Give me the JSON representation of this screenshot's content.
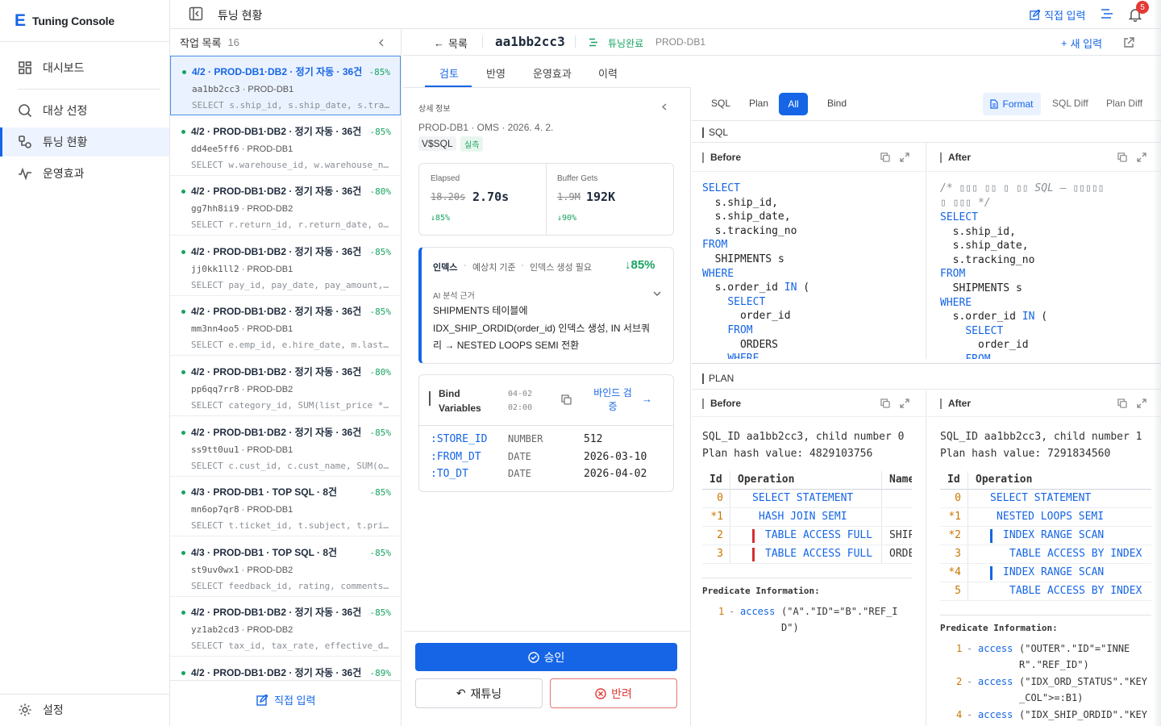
{
  "app": {
    "brand_letter": "E",
    "brand_name": "Tuning Console"
  },
  "sidebar": {
    "items": [
      {
        "label": "대시보드",
        "icon": "dashboard-icon"
      },
      {
        "label": "대상 선정",
        "icon": "search-icon"
      },
      {
        "label": "튜닝 현황",
        "icon": "tuning-icon",
        "active": true
      },
      {
        "label": "운영효과",
        "icon": "pulse-icon"
      }
    ],
    "settings_label": "설정"
  },
  "topbar": {
    "title": "튜닝 현황",
    "direct_input": "직접 입력",
    "notification_count": "5"
  },
  "queue": {
    "title": "작업 목록",
    "count": "16",
    "footer_button": "직접 입력",
    "items": [
      {
        "title": "4/2 · PROD-DB1·DB2 · 정기 자동 · 36건",
        "pct": "-85%",
        "id": "aa1bb2cc3",
        "db": "PROD-DB1",
        "sql": "SELECT s.ship_id, s.ship_date, s.tracking_no FROM SHIPMENTS s"
      },
      {
        "title": "4/2 · PROD-DB1·DB2 · 정기 자동 · 36건",
        "pct": "-85%",
        "id": "dd4ee5ff6",
        "db": "PROD-DB1",
        "sql": "SELECT w.warehouse_id, w.warehouse_name"
      },
      {
        "title": "4/2 · PROD-DB1·DB2 · 정기 자동 · 36건",
        "pct": "-80%",
        "id": "gg7hh8ii9",
        "db": "PROD-DB2",
        "sql": "SELECT r.return_id, r.return_date, o.order_id"
      },
      {
        "title": "4/2 · PROD-DB1·DB2 · 정기 자동 · 36건",
        "pct": "-85%",
        "id": "jj0kk1ll2",
        "db": "PROD-DB1",
        "sql": "SELECT pay_id, pay_date, pay_amount, status"
      },
      {
        "title": "4/2 · PROD-DB1·DB2 · 정기 자동 · 36건",
        "pct": "-85%",
        "id": "mm3nn4oo5",
        "db": "PROD-DB1",
        "sql": "SELECT e.emp_id, e.hire_date, m.last_name"
      },
      {
        "title": "4/2 · PROD-DB1·DB2 · 정기 자동 · 36건",
        "pct": "-80%",
        "id": "pp6qq7rr8",
        "db": "PROD-DB2",
        "sql": "SELECT category_id, SUM(list_price * qty)"
      },
      {
        "title": "4/2 · PROD-DB1·DB2 · 정기 자동 · 36건",
        "pct": "-85%",
        "id": "ss9tt0uu1",
        "db": "PROD-DB1",
        "sql": "SELECT c.cust_id, c.cust_name, SUM(o.amount)"
      },
      {
        "title": "4/3 · PROD-DB1 · TOP SQL · 8건",
        "pct": "-85%",
        "id": "mn6op7qr8",
        "db": "PROD-DB1",
        "sql": "SELECT t.ticket_id, t.subject, t.priority"
      },
      {
        "title": "4/3 · PROD-DB1 · TOP SQL · 8건",
        "pct": "-85%",
        "id": "st9uv0wx1",
        "db": "PROD-DB2",
        "sql": "SELECT feedback_id, rating, comments, created"
      },
      {
        "title": "4/2 · PROD-DB1·DB2 · 정기 자동 · 36건",
        "pct": "-85%",
        "id": "yz1ab2cd3",
        "db": "PROD-DB2",
        "sql": "SELECT tax_id, tax_rate, effective_date"
      },
      {
        "title": "4/2 · PROD-DB1·DB2 · 정기 자동 · 36건",
        "pct": "-89%",
        "id": "",
        "db": "",
        "sql": ""
      }
    ]
  },
  "detail": {
    "back_label": "목록",
    "sql_id": "aa1bb2cc3",
    "status": "튜닝완료",
    "db": "PROD-DB1",
    "new_input": "새 입력",
    "tabs": [
      "검토",
      "반영",
      "운영효과",
      "이력"
    ],
    "info_title": "상세 정보",
    "info_meta": "PROD-DB1 · OMS · 2026. 4. 2.",
    "source_tag": "V$SQL",
    "measure_tag": "실측",
    "metrics": [
      {
        "label": "Elapsed",
        "before": "18.20s",
        "after": "2.70s",
        "delta": "↓85%"
      },
      {
        "label": "Buffer Gets",
        "before": "1.9M",
        "after": "192K",
        "delta": "↓90%"
      }
    ],
    "recommendation": {
      "type": "인덱스",
      "basis": "예상치 기준",
      "action": "인덱스 생성 필요",
      "improvement": "↓85%",
      "ai_label": "AI 분석 근거",
      "ai_text": "SHIPMENTS 테이블에 IDX_SHIP_ORDID(order_id) 인덱스 생성, IN 서브쿼리 → NESTED LOOPS SEMI 전환"
    },
    "bind": {
      "title_line1": "Bind",
      "title_line2": "Variables",
      "date_line1": "04-02",
      "date_line2": "02:00",
      "verify_line1": "바인드 검",
      "verify_line2": "증",
      "vars": [
        {
          "name": ":STORE_ID",
          "type": "NUMBER",
          "value": "512"
        },
        {
          "name": ":FROM_DT",
          "type": "DATE",
          "value": "2026-03-10"
        },
        {
          "name": ":TO_DT",
          "type": "DATE",
          "value": "2026-04-02"
        }
      ]
    },
    "actions": {
      "approve": "승인",
      "retune": "재튜닝",
      "reject": "반려"
    }
  },
  "viewer": {
    "mode_tabs": [
      "SQL",
      "Plan",
      "All",
      "Bind"
    ],
    "active_mode": "All",
    "right_tabs": [
      "Format",
      "SQL Diff",
      "Plan Diff"
    ],
    "sql_section": "SQL",
    "plan_section": "PLAN",
    "before_label": "Before",
    "after_label": "After",
    "sql_before": [
      "SELECT",
      "  s.ship_id,",
      "  s.ship_date,",
      "  s.tracking_no",
      "FROM",
      "  SHIPMENTS s",
      "WHERE",
      "  s.order_id IN (",
      "    SELECT",
      "      order_id",
      "    FROM",
      "      ORDERS",
      "    WHERE"
    ],
    "sql_after_comment_1": "/* ▯▯▯ ▯▯ ▯ ▯▯ SQL — ▯▯▯▯▯",
    "sql_after_comment_2": "▯ ▯▯▯ */",
    "sql_after": [
      "SELECT",
      "  s.ship_id,",
      "  s.ship_date,",
      "  s.tracking_no",
      "FROM",
      "  SHIPMENTS s",
      "WHERE",
      "  s.order_id IN (",
      "    SELECT",
      "      order_id",
      "    FROM"
    ],
    "plan_before": {
      "line1": "SQL_ID aa1bb2cc3, child number 0",
      "line2": "Plan hash value: 4829103756",
      "headers": [
        "Id",
        "Operation",
        "Name"
      ],
      "rows": [
        {
          "id": "0",
          "op": "SELECT STATEMENT",
          "name": ""
        },
        {
          "id": "*1",
          "op": "HASH JOIN SEMI",
          "name": ""
        },
        {
          "id": "2",
          "op": "TABLE ACCESS FULL",
          "name": "SHIP"
        },
        {
          "id": "3",
          "op": "TABLE ACCESS FULL",
          "name": "ORDE"
        }
      ],
      "pred_title": "Predicate Information:",
      "preds": [
        {
          "n": "1",
          "kind": "access",
          "text1": "(\"A\".\"ID\"=\"B\".\"REF_I",
          "text2": "D\")"
        }
      ]
    },
    "plan_after": {
      "line1": "SQL_ID aa1bb2cc3, child number 1",
      "line2": "Plan hash value: 7291834560",
      "headers": [
        "Id",
        "Operation"
      ],
      "rows": [
        {
          "id": "0",
          "op": "SELECT STATEMENT"
        },
        {
          "id": "*1",
          "op": "NESTED LOOPS SEMI"
        },
        {
          "id": "*2",
          "op": "INDEX RANGE SCAN"
        },
        {
          "id": "3",
          "op": "TABLE ACCESS BY INDEX"
        },
        {
          "id": "*4",
          "op": "INDEX RANGE SCAN"
        },
        {
          "id": "5",
          "op": "TABLE ACCESS BY INDEX"
        }
      ],
      "pred_title": "Predicate Information:",
      "preds": [
        {
          "n": "1",
          "kind": "access",
          "text1": "(\"OUTER\".\"ID\"=\"INNE",
          "text2": "R\".\"REF_ID\")"
        },
        {
          "n": "2",
          "kind": "access",
          "text1": "(\"IDX_ORD_STATUS\".\"KEY",
          "text2": "_COL\">=:B1)"
        },
        {
          "n": "4",
          "kind": "access",
          "text1": "(\"IDX_SHIP_ORDID\".\"KEY",
          "text2": ""
        }
      ]
    }
  },
  "colors": {
    "accent": "#1565e6",
    "success": "#17a362",
    "danger": "#e53935"
  }
}
